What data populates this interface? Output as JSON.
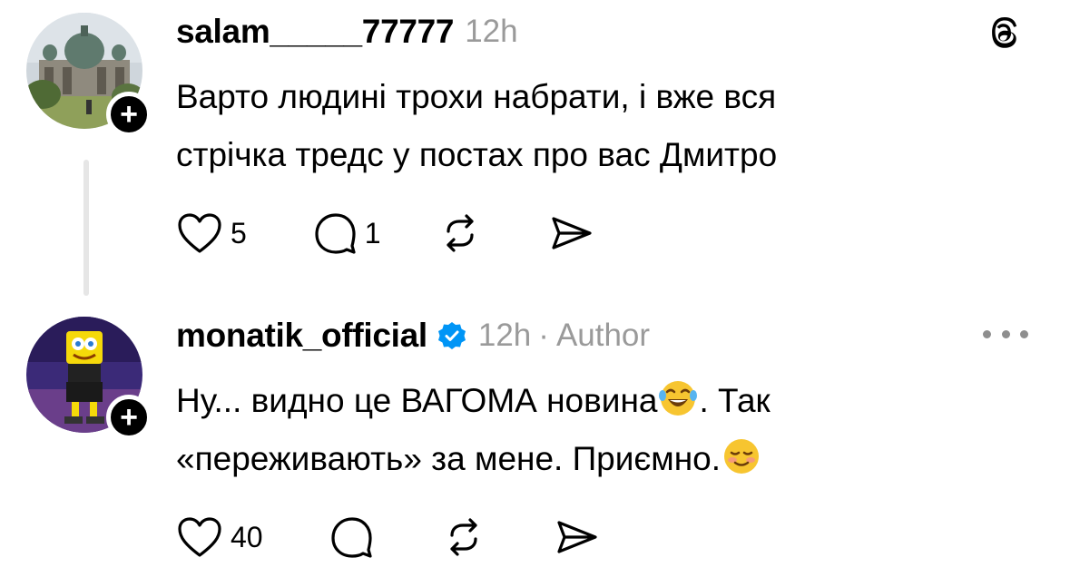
{
  "posts": [
    {
      "username": "salam_____77777",
      "time": "12h",
      "author_tag": "",
      "text_lines": [
        "Варто людині трохи набрати, і вже вся",
        "стрічка тредс у постах про вас Дмитро"
      ],
      "likes": "5",
      "replies": "1",
      "follow_symbol": "+"
    },
    {
      "username": "monatik_official",
      "time": "12h",
      "separator": "·",
      "author_tag": "Author",
      "text_line1": "Ну... видно це ВАГОМА новина",
      "text_line1_end": ". Так",
      "text_line2": "«переживають» за мене. Приємно.",
      "likes": "40",
      "replies": "",
      "follow_symbol": "+"
    }
  ],
  "icons": {
    "header_right_post1": "threads-logo-icon",
    "header_right_post2": "more-dots-icon",
    "actions": [
      "heart-icon",
      "comment-icon",
      "repost-icon",
      "share-icon"
    ],
    "emojis": [
      "tears-of-joy-emoji",
      "smiling-blushing-emoji"
    ]
  },
  "colors": {
    "text": "#000000",
    "muted": "#9a9a9a",
    "verified": "#0095f6",
    "thread_line": "#e6e6e6"
  }
}
